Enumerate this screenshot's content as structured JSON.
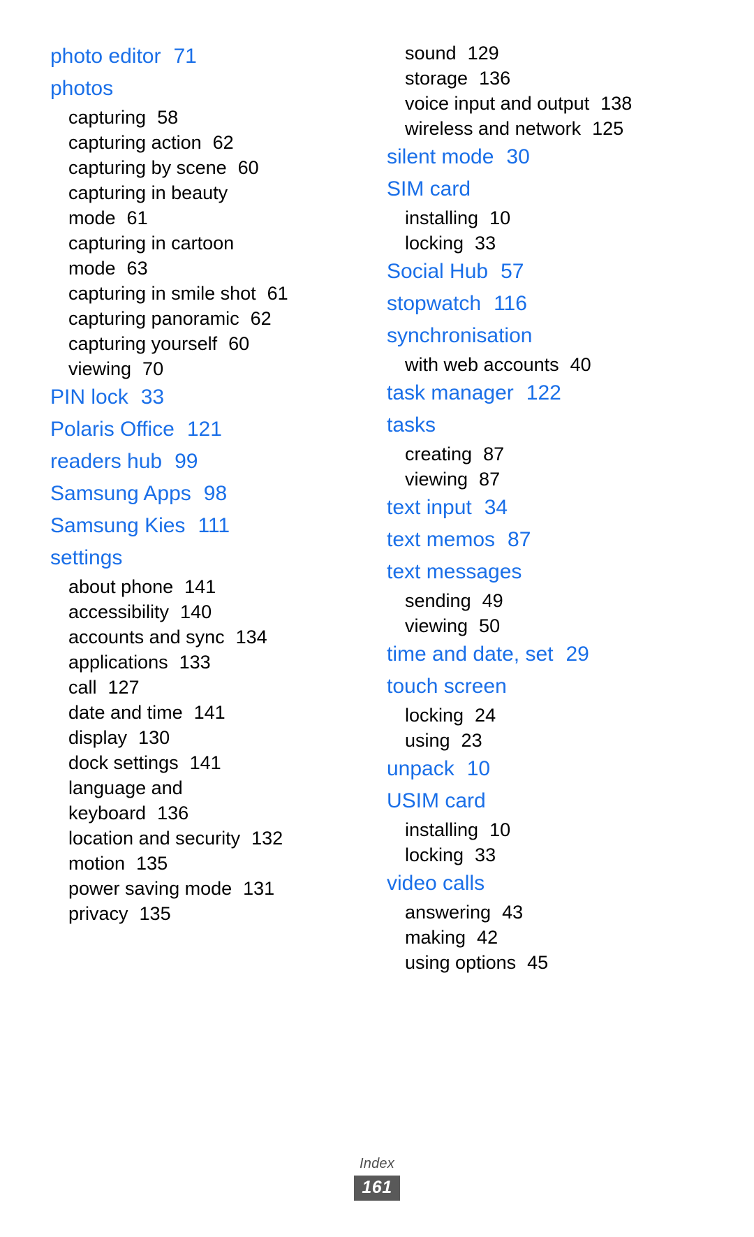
{
  "document": {
    "footer_label": "Index",
    "page_number": "161",
    "accent_color": "#1a6fe8",
    "text_color": "#000000",
    "footer_box_color": "#595959"
  },
  "columns": [
    {
      "name": "left-column",
      "entries": [
        {
          "type": "main",
          "label": "photo editor",
          "page": "71"
        },
        {
          "type": "main",
          "label": "photos",
          "page": ""
        },
        {
          "type": "sub",
          "label": "capturing",
          "page": "58"
        },
        {
          "type": "sub",
          "label": "capturing action",
          "page": "62"
        },
        {
          "type": "sub",
          "label": "capturing by scene",
          "page": "60"
        },
        {
          "type": "sub",
          "label": "capturing in beauty",
          "page": ""
        },
        {
          "type": "sub-cont",
          "label": "mode",
          "page": "61"
        },
        {
          "type": "sub",
          "label": "capturing in cartoon",
          "page": ""
        },
        {
          "type": "sub-cont",
          "label": "mode",
          "page": "63"
        },
        {
          "type": "sub",
          "label": "capturing in smile shot",
          "page": "61"
        },
        {
          "type": "sub",
          "label": "capturing panoramic",
          "page": "62"
        },
        {
          "type": "sub",
          "label": "capturing yourself",
          "page": "60"
        },
        {
          "type": "sub",
          "label": "viewing",
          "page": "70"
        },
        {
          "type": "main",
          "label": "PIN lock",
          "page": "33"
        },
        {
          "type": "main",
          "label": "Polaris Office",
          "page": "121"
        },
        {
          "type": "main",
          "label": "readers hub",
          "page": "99"
        },
        {
          "type": "main",
          "label": "Samsung Apps",
          "page": "98"
        },
        {
          "type": "main",
          "label": "Samsung Kies",
          "page": "111"
        },
        {
          "type": "main",
          "label": "settings",
          "page": ""
        },
        {
          "type": "sub",
          "label": "about phone",
          "page": "141"
        },
        {
          "type": "sub",
          "label": "accessibility",
          "page": "140"
        },
        {
          "type": "sub",
          "label": "accounts and sync",
          "page": "134"
        },
        {
          "type": "sub",
          "label": "applications",
          "page": "133"
        },
        {
          "type": "sub",
          "label": "call",
          "page": "127"
        },
        {
          "type": "sub",
          "label": "date and time",
          "page": "141"
        },
        {
          "type": "sub",
          "label": "display",
          "page": "130"
        },
        {
          "type": "sub",
          "label": "dock settings",
          "page": "141"
        },
        {
          "type": "sub",
          "label": "language and",
          "page": ""
        },
        {
          "type": "sub-cont",
          "label": "keyboard",
          "page": "136"
        },
        {
          "type": "sub",
          "label": "location and security",
          "page": "132"
        },
        {
          "type": "sub",
          "label": "motion",
          "page": "135"
        },
        {
          "type": "sub",
          "label": "power saving mode",
          "page": "131"
        },
        {
          "type": "sub",
          "label": "privacy",
          "page": "135"
        }
      ]
    },
    {
      "name": "right-column",
      "entries": [
        {
          "type": "sub",
          "label": "sound",
          "page": "129"
        },
        {
          "type": "sub",
          "label": "storage",
          "page": "136"
        },
        {
          "type": "sub",
          "label": "voice input and output",
          "page": "138"
        },
        {
          "type": "sub",
          "label": "wireless and network",
          "page": "125"
        },
        {
          "type": "main",
          "label": "silent mode",
          "page": "30"
        },
        {
          "type": "main",
          "label": "SIM card",
          "page": ""
        },
        {
          "type": "sub",
          "label": "installing",
          "page": "10"
        },
        {
          "type": "sub",
          "label": "locking",
          "page": "33"
        },
        {
          "type": "main",
          "label": "Social Hub",
          "page": "57"
        },
        {
          "type": "main",
          "label": "stopwatch",
          "page": "116"
        },
        {
          "type": "main",
          "label": "synchronisation",
          "page": ""
        },
        {
          "type": "sub",
          "label": "with web accounts",
          "page": "40"
        },
        {
          "type": "main",
          "label": "task manager",
          "page": "122"
        },
        {
          "type": "main",
          "label": "tasks",
          "page": ""
        },
        {
          "type": "sub",
          "label": "creating",
          "page": "87"
        },
        {
          "type": "sub",
          "label": "viewing",
          "page": "87"
        },
        {
          "type": "main",
          "label": "text input",
          "page": "34"
        },
        {
          "type": "main",
          "label": "text memos",
          "page": "87"
        },
        {
          "type": "main",
          "label": "text messages",
          "page": ""
        },
        {
          "type": "sub",
          "label": "sending",
          "page": "49"
        },
        {
          "type": "sub",
          "label": "viewing",
          "page": "50"
        },
        {
          "type": "main",
          "label": "time and date, set",
          "page": "29"
        },
        {
          "type": "main",
          "label": "touch screen",
          "page": ""
        },
        {
          "type": "sub",
          "label": "locking",
          "page": "24"
        },
        {
          "type": "sub",
          "label": "using",
          "page": "23"
        },
        {
          "type": "main",
          "label": "unpack",
          "page": "10"
        },
        {
          "type": "main",
          "label": "USIM card",
          "page": ""
        },
        {
          "type": "sub",
          "label": "installing",
          "page": "10"
        },
        {
          "type": "sub",
          "label": "locking",
          "page": "33"
        },
        {
          "type": "main",
          "label": "video calls",
          "page": ""
        },
        {
          "type": "sub",
          "label": "answering",
          "page": "43"
        },
        {
          "type": "sub",
          "label": "making",
          "page": "42"
        },
        {
          "type": "sub",
          "label": "using options",
          "page": "45"
        }
      ]
    }
  ]
}
